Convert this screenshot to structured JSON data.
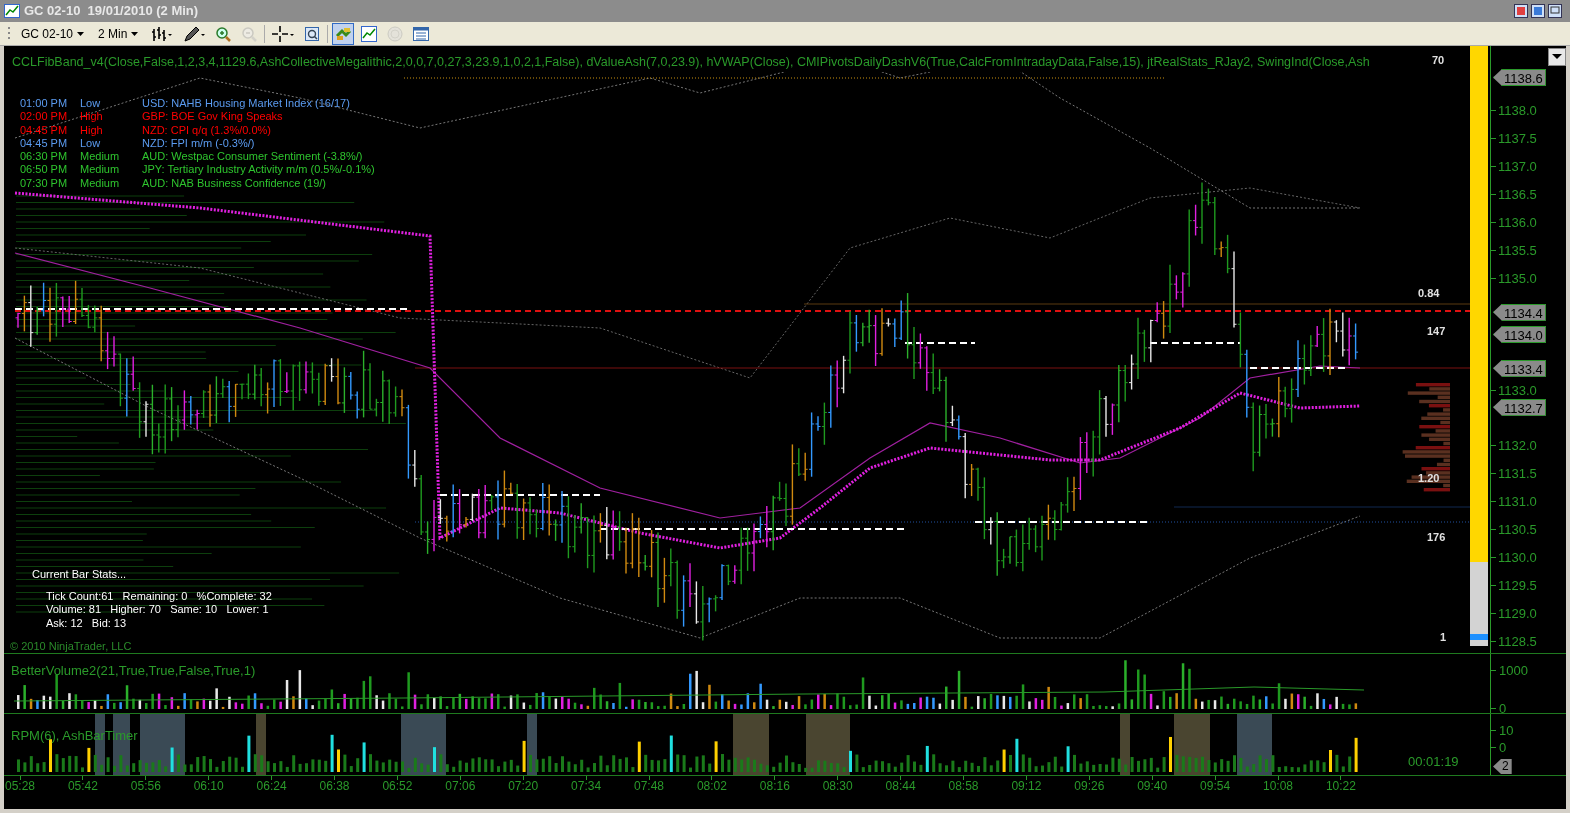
{
  "window": {
    "title": "GC 02-10  19/01/2010 (2 Min)"
  },
  "toolbar": {
    "instrument": "GC 02-10",
    "interval": "2 Min",
    "tools": [
      {
        "kind": "bars",
        "pressed": false,
        "disabled": false
      },
      {
        "kind": "pencil",
        "pressed": false,
        "disabled": false
      },
      {
        "kind": "zoomin",
        "pressed": false,
        "disabled": false
      },
      {
        "kind": "zoomout",
        "pressed": false,
        "disabled": true
      },
      {
        "kind": "crosshair",
        "pressed": false,
        "disabled": false
      },
      {
        "kind": "properties",
        "pressed": false,
        "disabled": false
      },
      {
        "kind": "link",
        "pressed": true,
        "disabled": false
      },
      {
        "kind": "chart",
        "pressed": false,
        "disabled": false
      },
      {
        "kind": "coin",
        "pressed": false,
        "disabled": true
      },
      {
        "kind": "list",
        "pressed": false,
        "disabled": false
      }
    ]
  },
  "main_panel": {
    "indicators": "CCLFibBand_v4(Close,False,1,2,3,4,1129.6,AshCollectiveMegalithic,2,0,0,7,0,27,3,23.9,1,0,2,1,False), dValueAsh(7,0,23.9), hVWAP(Close), CMIPivotsDailyDashV6(True,CalcFromIntradayData,False,15), jtRealStats_RJay2, SwingInd(Close,Ash",
    "events": [
      {
        "time": "01:00 PM",
        "impact": "Low",
        "text": "USD: NAHB Housing Market Index (16/17)",
        "color": "#5b9bf0"
      },
      {
        "time": "02:00 PM",
        "impact": "High",
        "text": "GBP: BOE Gov King Speaks",
        "color": "#ff0000"
      },
      {
        "time": "04:45 PM",
        "impact": "High",
        "text": "NZD: CPI q/q (1.3%/0.0%)",
        "color": "#ff0000"
      },
      {
        "time": "04:45 PM",
        "impact": "Low",
        "text": "NZD: FPI m/m (-0.3%/)",
        "color": "#5b9bf0"
      },
      {
        "time": "06:30 PM",
        "impact": "Medium",
        "text": "AUD: Westpac Consumer Sentiment (-3.8%/)",
        "color": "#2ec52e"
      },
      {
        "time": "06:50 PM",
        "impact": "Medium",
        "text": "JPY: Tertiary Industry Activity m/m (0.5%/-0.1%)",
        "color": "#2ec52e"
      },
      {
        "time": "07:30 PM",
        "impact": "Medium",
        "text": "AUD: NAB Business Confidence (19/)",
        "color": "#2ec52e"
      }
    ],
    "stats_labels": [
      "70",
      "0.84",
      "147",
      "1.20",
      "176",
      "1"
    ],
    "current_bar_stats": {
      "title": "Current Bar Stats...",
      "lines": [
        "Tick Count:61   Remaining: 0   %Complete: 32",
        "Volume: 81   Higher: 70   Same: 10   Lower: 1",
        "Ask: 12   Bid: 13"
      ]
    },
    "copyright": "© 2010 NinjaTrader, LLC",
    "bar_timer_meter": {
      "level": 0.86
    },
    "price_axis": [
      "1138.0",
      "1137.5",
      "1137.0",
      "1136.5",
      "1136.0",
      "1135.5",
      "1135.0",
      "1133.0",
      "1132.0",
      "1131.5",
      "1131.0",
      "1130.5",
      "1130.0",
      "1129.5",
      "1129.0",
      "1128.5"
    ],
    "price_markers": [
      "1138.6",
      "1134.4",
      "1134.0",
      "1133.4",
      "1132.7"
    ]
  },
  "volume_panel": {
    "label": "BetterVolume2(21,True,True,False,True,1)",
    "axis": [
      "1000",
      "0"
    ]
  },
  "rpm_panel": {
    "label": "RPM(6), AshBarTimer",
    "axis": [
      "10",
      "0"
    ],
    "marker": "2",
    "timer": "00:01:19"
  },
  "time_axis": [
    "05:28",
    "05:42",
    "05:56",
    "06:10",
    "06:24",
    "06:38",
    "06:52",
    "07:06",
    "07:20",
    "07:34",
    "07:48",
    "08:02",
    "08:16",
    "08:30",
    "08:44",
    "08:58",
    "09:12",
    "09:26",
    "09:40",
    "09:54",
    "10:08",
    "10:22"
  ]
}
